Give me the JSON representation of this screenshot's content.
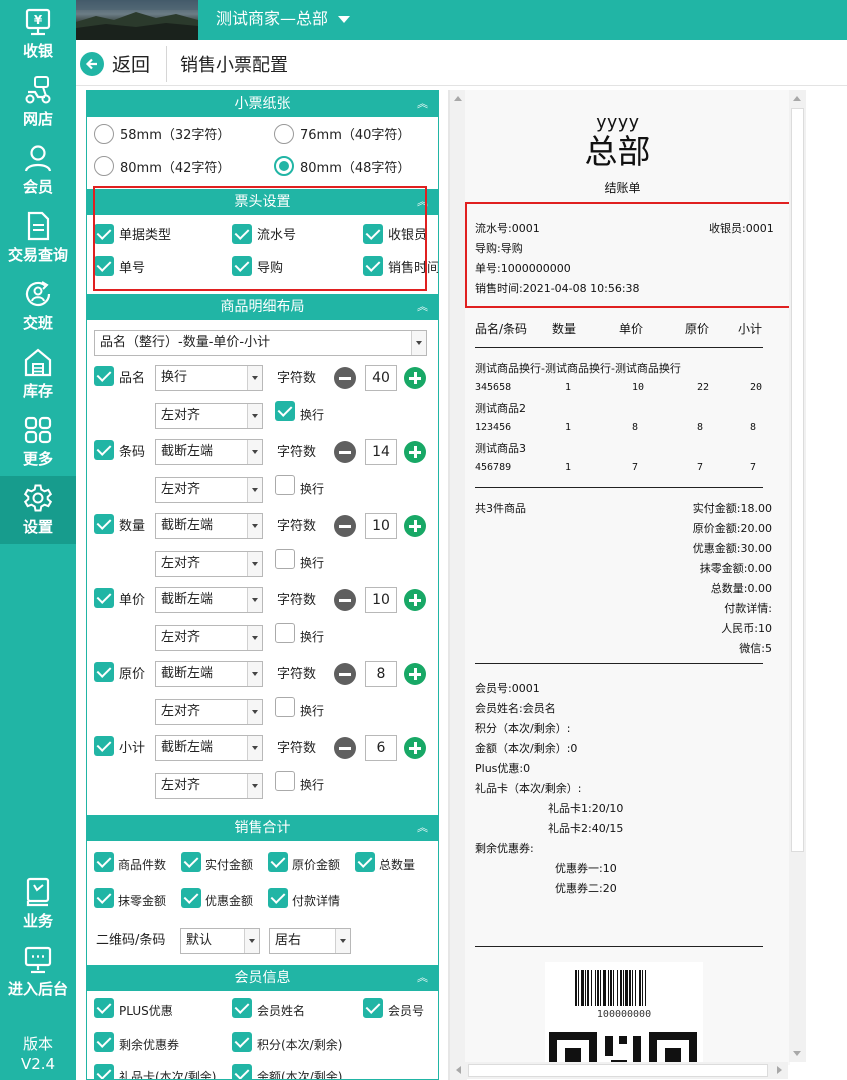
{
  "sidebar": {
    "items": [
      {
        "label": "收银",
        "icon": "cashier-icon"
      },
      {
        "label": "网店",
        "icon": "scooter-icon"
      },
      {
        "label": "会员",
        "icon": "user-icon"
      },
      {
        "label": "交易查询",
        "icon": "document-icon"
      },
      {
        "label": "交班",
        "icon": "shift-handover-icon"
      },
      {
        "label": "库存",
        "icon": "warehouse-icon"
      },
      {
        "label": "更多",
        "icon": "grid-icon"
      },
      {
        "label": "设置",
        "icon": "gear-icon"
      },
      {
        "label": "业务",
        "icon": "book-icon"
      },
      {
        "label": "进入后台",
        "icon": "monitor-icon"
      }
    ],
    "active": "设置",
    "version_label": "版本",
    "version": "V2.4"
  },
  "topbar": {
    "store_name": "测试商家—总部"
  },
  "subbar": {
    "back_label": "返回",
    "page_title": "销售小票配置"
  },
  "colors": {
    "accent": "#21b5a5",
    "active_nav": "#179c8d",
    "plus_green": "#18a866",
    "highlight_red": "#e02020"
  },
  "paper": {
    "title": "小票纸张",
    "options": [
      {
        "label": "58mm（32字符）",
        "selected": false
      },
      {
        "label": "76mm（40字符）",
        "selected": false
      },
      {
        "label": "80mm（42字符）",
        "selected": false
      },
      {
        "label": "80mm（48字符）",
        "selected": true
      }
    ]
  },
  "header_settings": {
    "title": "票头设置",
    "items": [
      {
        "label": "单据类型",
        "checked": true
      },
      {
        "label": "流水号",
        "checked": true
      },
      {
        "label": "收银员",
        "checked": true
      },
      {
        "label": "单号",
        "checked": true
      },
      {
        "label": "导购",
        "checked": true
      },
      {
        "label": "销售时间",
        "checked": true
      }
    ]
  },
  "detail_layout": {
    "title": "商品明细布局",
    "layout_value": "品名（整行）-数量-单价-小计",
    "chars_label": "字符数",
    "wrap_label": "换行",
    "fields": [
      {
        "label": "品名",
        "checked": true,
        "mode": "换行",
        "align": "左对齐",
        "chars": "40",
        "wrap": true
      },
      {
        "label": "条码",
        "checked": true,
        "mode": "截断左端",
        "align": "左对齐",
        "chars": "14",
        "wrap": false
      },
      {
        "label": "数量",
        "checked": true,
        "mode": "截断左端",
        "align": "左对齐",
        "chars": "10",
        "wrap": false
      },
      {
        "label": "单价",
        "checked": true,
        "mode": "截断左端",
        "align": "左对齐",
        "chars": "10",
        "wrap": false
      },
      {
        "label": "原价",
        "checked": true,
        "mode": "截断左端",
        "align": "左对齐",
        "chars": "8",
        "wrap": false
      },
      {
        "label": "小计",
        "checked": true,
        "mode": "截断左端",
        "align": "左对齐",
        "chars": "6",
        "wrap": false
      }
    ]
  },
  "sales_total": {
    "title": "销售合计",
    "items": [
      {
        "label": "商品件数",
        "checked": true
      },
      {
        "label": "实付金额",
        "checked": true
      },
      {
        "label": "原价金额",
        "checked": true
      },
      {
        "label": "总数量",
        "checked": true
      },
      {
        "label": "抹零金额",
        "checked": true
      },
      {
        "label": "优惠金额",
        "checked": true
      },
      {
        "label": "付款详情",
        "checked": true
      }
    ],
    "qr_label": "二维码/条码",
    "qr_value": "默认",
    "pos_value": "居右"
  },
  "member_info": {
    "title": "会员信息",
    "items": [
      {
        "label": "PLUS优惠",
        "checked": true
      },
      {
        "label": "会员姓名",
        "checked": true
      },
      {
        "label": "会员号",
        "checked": true
      },
      {
        "label": "剩余优惠券",
        "checked": true
      },
      {
        "label": "积分(本次/剩余)",
        "checked": true
      },
      {
        "label": "礼品卡(本次/剩余)",
        "checked": true
      },
      {
        "label": "余额(本次/剩余)",
        "checked": true
      }
    ]
  },
  "receipt": {
    "brand": "yyyy",
    "store": "总部",
    "doc_type": "结账单",
    "serial": "流水号:0001",
    "cashier": "收银员:0001",
    "guide": "导购:导购",
    "order_no": "单号:1000000000",
    "sale_time": "销售时间:2021-04-08 10:56:38",
    "columns": [
      "品名/条码",
      "数量",
      "单价",
      "原价",
      "小计"
    ],
    "items": [
      {
        "name": "测试商品换行-测试商品换行-测试商品换行",
        "code": "345658",
        "qty": "1",
        "price": "10",
        "orig": "22",
        "subtotal": "20"
      },
      {
        "name": "测试商品2",
        "code": "123456",
        "qty": "1",
        "price": "8",
        "orig": "8",
        "subtotal": "8"
      },
      {
        "name": "测试商品3",
        "code": "456789",
        "qty": "1",
        "price": "7",
        "orig": "7",
        "subtotal": "7"
      }
    ],
    "count_text": "共3件商品",
    "totals": [
      "实付金额:18.00",
      "原价金额:20.00",
      "优惠金额:30.00",
      "抹零金额:0.00",
      "总数量:0.00",
      "付款详情:",
      "人民币:10",
      "微信:5"
    ],
    "member": [
      "会员号:0001",
      "会员姓名:会员名",
      "积分（本次/剩余）:",
      "金额（本次/剩余）:0",
      "Plus优惠:0",
      "礼品卡（本次/剩余）:"
    ],
    "gift_cards": [
      "礼品卡1:20/10",
      "礼品卡2:40/15"
    ],
    "coupon_label": "剩余优惠券:",
    "coupons": [
      "优惠券一:10",
      "优惠券二:20"
    ],
    "barcode_number": "100000000"
  }
}
